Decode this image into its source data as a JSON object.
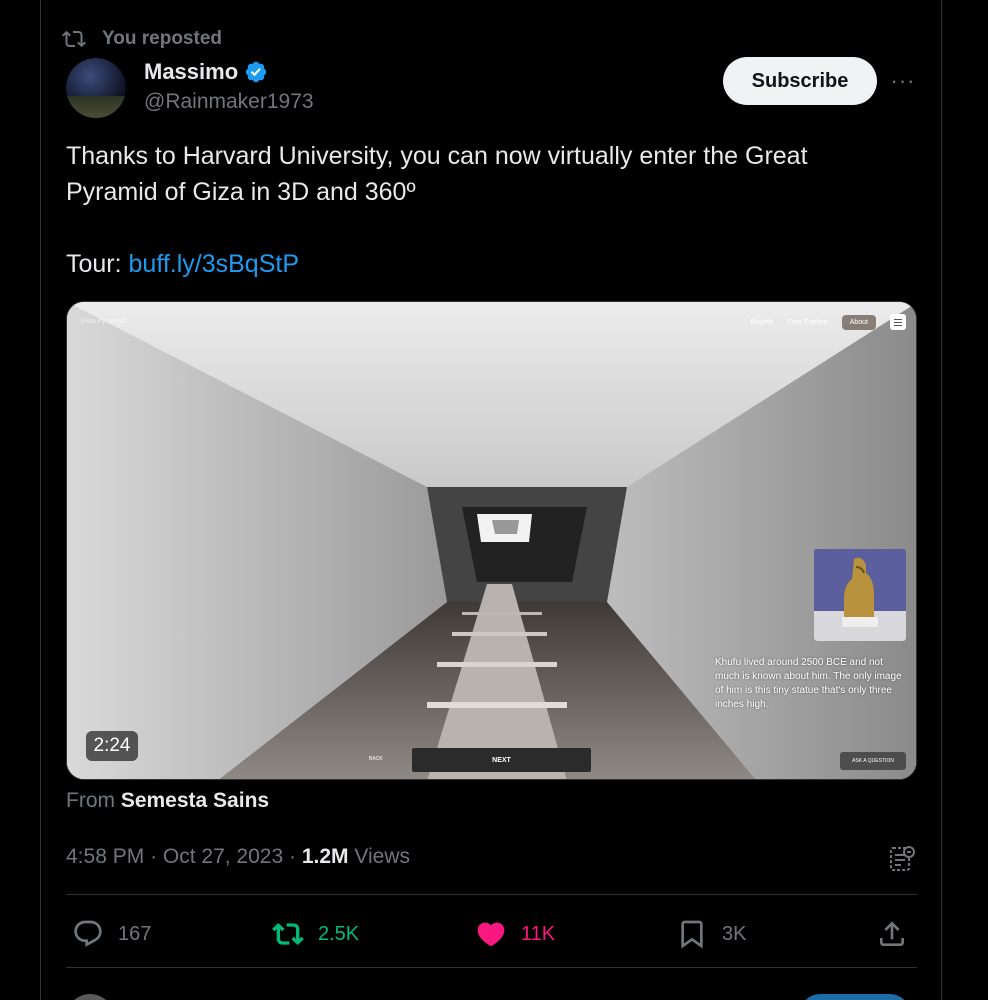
{
  "repost": {
    "label": "You reposted"
  },
  "author": {
    "name": "Massimo",
    "handle": "@Rainmaker1973"
  },
  "actions_top": {
    "subscribe_label": "Subscribe",
    "more_label": "···"
  },
  "tweet": {
    "line1": "Thanks to Harvard University, you can now virtually enter the Great",
    "line2": "Pyramid of Giza in 3D and 360º",
    "tour_label": "Tour: ",
    "tour_link": "buff.ly/3sBqStP"
  },
  "video": {
    "duration": "2:24",
    "top_left": "Giza Pyramids",
    "language": "English",
    "free_explore": "Free Explore",
    "about": "About",
    "caption": "Khufu lived around 2500 BCE and not much is known about him. The only image of him is this tiny statue that's only three inches high.",
    "next_label": "NEXT",
    "back_label": "BACK",
    "ask_label": "ASK A QUESTION"
  },
  "source": {
    "prefix": "From ",
    "name": "Semesta Sains"
  },
  "meta": {
    "time": "4:58 PM",
    "date": "Oct 27, 2023",
    "views_count": "1.2M",
    "views_label": "Views"
  },
  "stats": {
    "replies": "167",
    "reposts": "2.5K",
    "likes": "11K",
    "bookmarks": "3K"
  },
  "colors": {
    "accent": "#1d9bf0",
    "repost_green": "#00ba7c",
    "like_pink": "#f91880",
    "muted": "#71767b"
  }
}
